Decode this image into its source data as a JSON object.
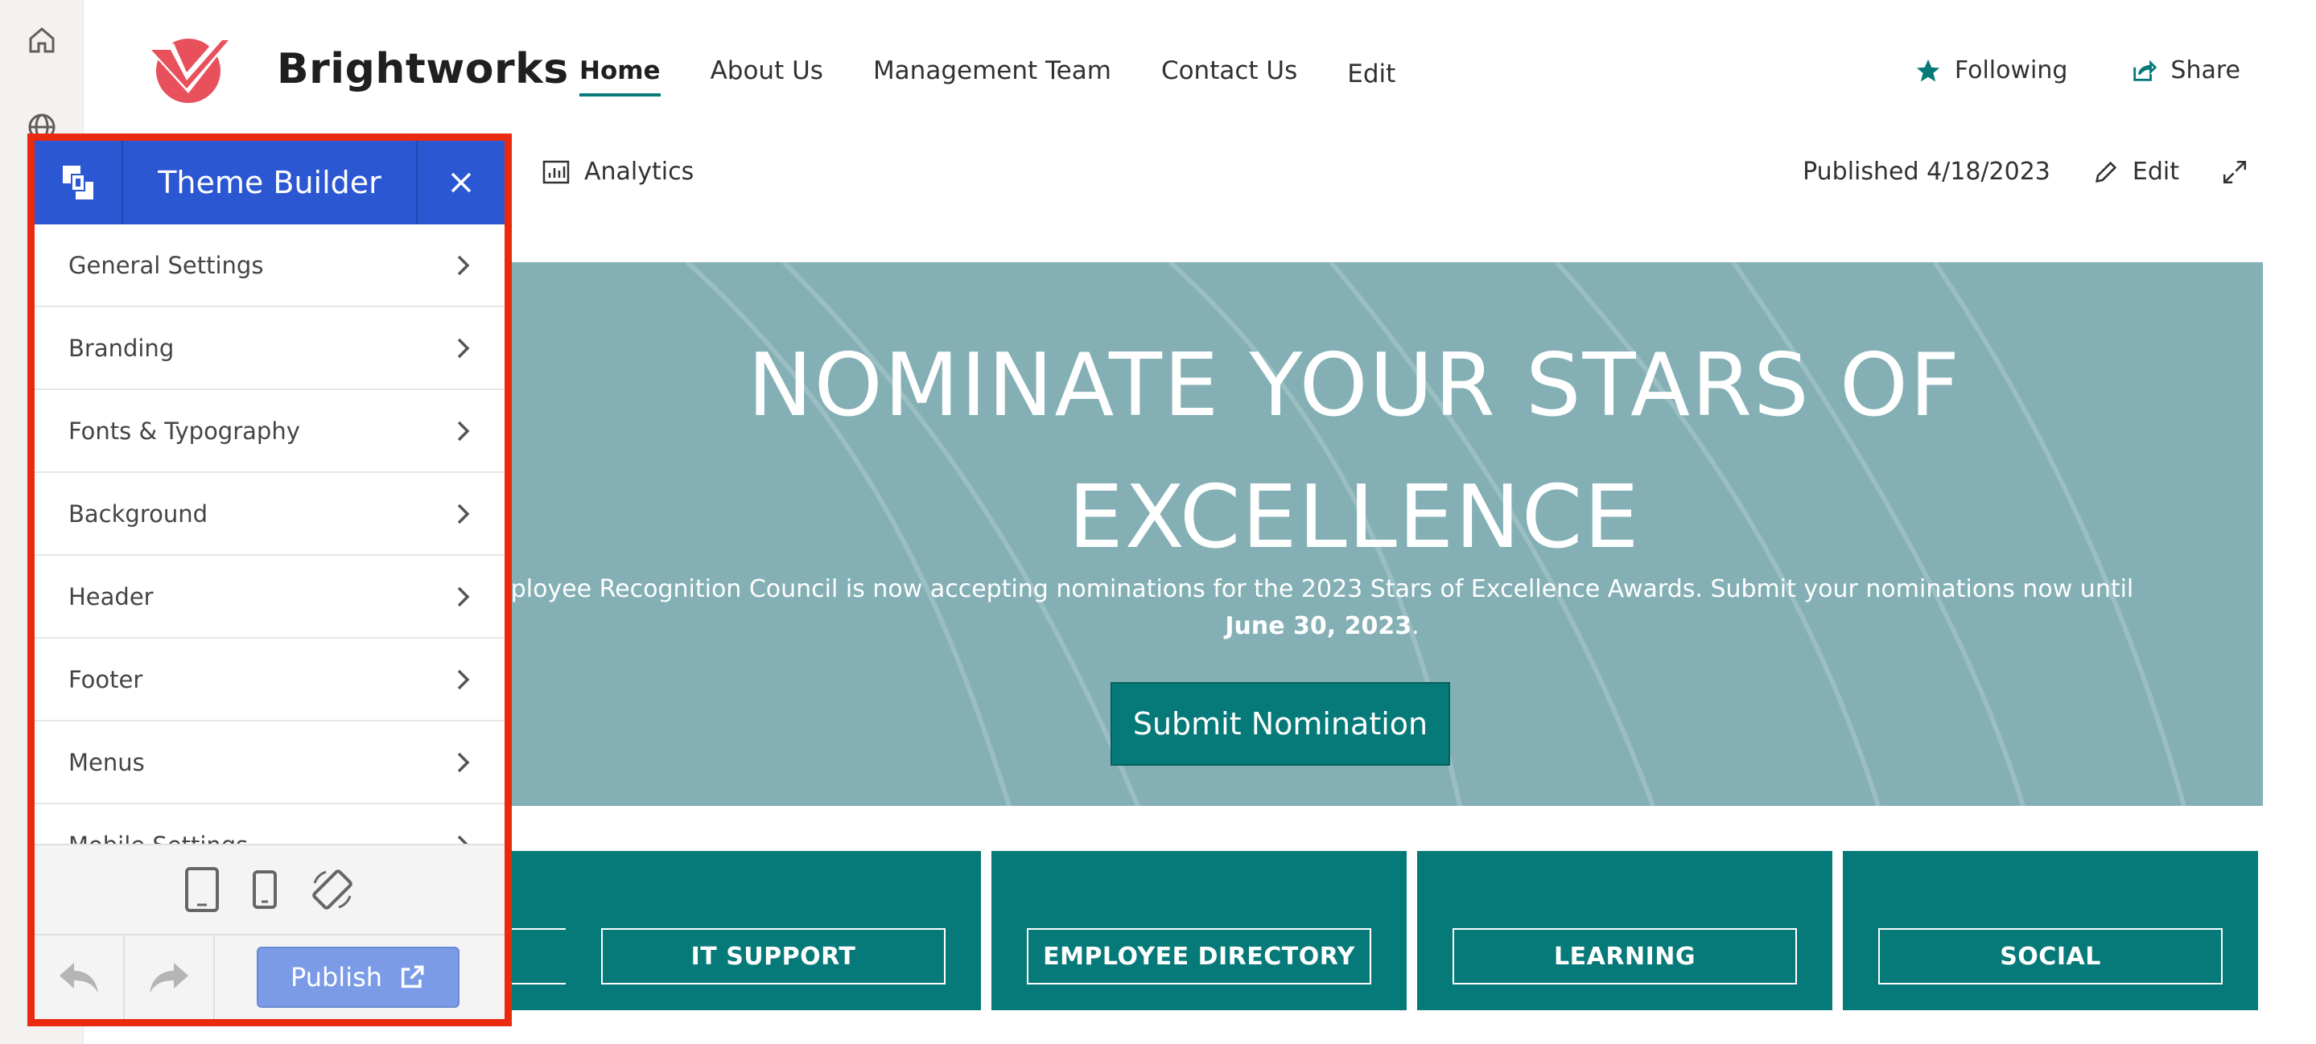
{
  "site": {
    "title": "Brightworks",
    "nav": [
      "Home",
      "About Us",
      "Management Team",
      "Contact Us",
      "Edit"
    ],
    "following_label": "Following",
    "share_label": "Share"
  },
  "commandbar": {
    "analytics_label": "Analytics",
    "published_label": "Published 4/18/2023",
    "edit_label": "Edit"
  },
  "hero": {
    "title_line1": "NOMINATE YOUR STARS OF",
    "title_line2": "EXCELLENCE",
    "description": "ployee Recognition Council is now accepting nominations for the 2023 Stars of Excellence Awards. Submit your nominations now until",
    "deadline": "June 30, 2023",
    "deadline_suffix": ".",
    "button_label": "Submit Nomination"
  },
  "tiles": [
    "",
    "IT SUPPORT",
    "EMPLOYEE DIRECTORY",
    "LEARNING",
    "SOCIAL"
  ],
  "theme_builder": {
    "title": "Theme Builder",
    "items": [
      "General Settings",
      "Branding",
      "Fonts & Typography",
      "Background",
      "Header",
      "Footer",
      "Menus",
      "Mobile Settings"
    ],
    "publish_label": "Publish"
  },
  "colors": {
    "accent_teal": "#067a79",
    "hero_bg": "#84b0b5",
    "panel_header": "#2b57d2",
    "highlight_border": "#ea2a0f",
    "logo_red": "#e8505b",
    "publish_button": "#7b9be6"
  },
  "icons": {
    "rail": [
      "home-icon",
      "globe-icon"
    ],
    "following": "star-icon",
    "share": "share-icon",
    "analytics": "analytics-icon",
    "edit": "pencil-icon",
    "expand": "expand-icon"
  }
}
